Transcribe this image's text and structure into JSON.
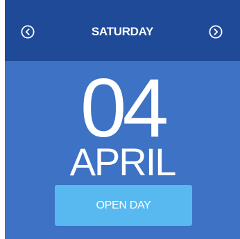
{
  "header": {
    "day": "SATURDAY",
    "prev_icon": "chevron-left-circle-icon",
    "next_icon": "chevron-right-circle-icon"
  },
  "date": {
    "day_number": "04",
    "month": "APRIL"
  },
  "action": {
    "label": "OPEN DAY"
  },
  "colors": {
    "header_bg": "#1e4a98",
    "body_bg": "#3d72c4",
    "button_bg": "#57b9ef",
    "text": "#ffffff"
  }
}
